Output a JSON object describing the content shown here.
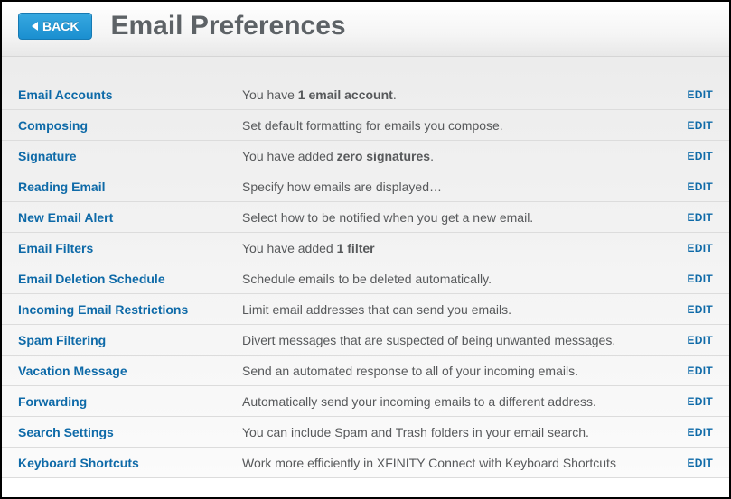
{
  "header": {
    "back_label": "BACK",
    "page_title": "Email Preferences"
  },
  "edit_label": "EDIT",
  "rows": [
    {
      "label": "Email Accounts",
      "desc_pre": "You have ",
      "desc_bold": "1 email account",
      "desc_post": "."
    },
    {
      "label": "Composing",
      "desc_pre": "Set default formatting for emails you compose.",
      "desc_bold": "",
      "desc_post": ""
    },
    {
      "label": "Signature",
      "desc_pre": "You have added ",
      "desc_bold": "zero signatures",
      "desc_post": "."
    },
    {
      "label": "Reading Email",
      "desc_pre": "Specify how emails are displayed…",
      "desc_bold": "",
      "desc_post": ""
    },
    {
      "label": "New Email Alert",
      "desc_pre": "Select how to be notified when you get a new email.",
      "desc_bold": "",
      "desc_post": ""
    },
    {
      "label": "Email Filters",
      "desc_pre": "You have added ",
      "desc_bold": "1 filter",
      "desc_post": ""
    },
    {
      "label": "Email Deletion Schedule",
      "desc_pre": "Schedule emails to be deleted automatically.",
      "desc_bold": "",
      "desc_post": ""
    },
    {
      "label": "Incoming Email Restrictions",
      "desc_pre": "Limit email addresses that can send you emails.",
      "desc_bold": "",
      "desc_post": ""
    },
    {
      "label": "Spam Filtering",
      "desc_pre": "Divert messages that are suspected of being unwanted messages.",
      "desc_bold": "",
      "desc_post": ""
    },
    {
      "label": "Vacation Message",
      "desc_pre": "Send an automated response to all of your incoming emails.",
      "desc_bold": "",
      "desc_post": ""
    },
    {
      "label": "Forwarding",
      "desc_pre": "Automatically send your incoming emails to a different address.",
      "desc_bold": "",
      "desc_post": ""
    },
    {
      "label": "Search Settings",
      "desc_pre": "You can include Spam and Trash folders in your email search.",
      "desc_bold": "",
      "desc_post": ""
    },
    {
      "label": "Keyboard Shortcuts",
      "desc_pre": "Work more efficiently in XFINITY Connect with Keyboard Shortcuts",
      "desc_bold": "",
      "desc_post": ""
    }
  ]
}
